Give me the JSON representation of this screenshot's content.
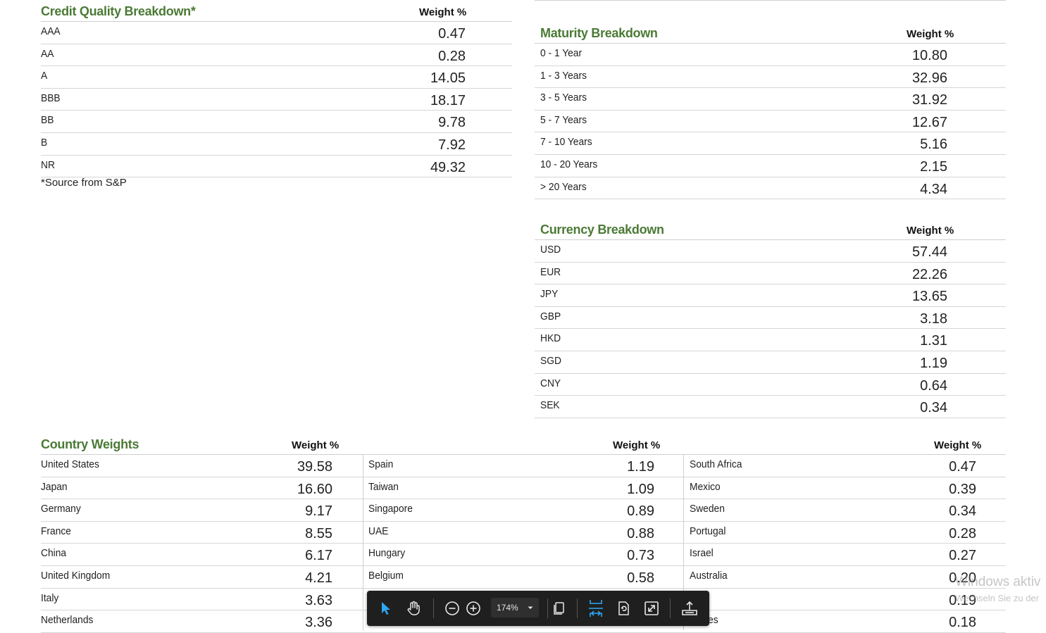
{
  "credit": {
    "title": "Credit Quality Breakdown*",
    "weight_header": "Weight %",
    "rows": [
      {
        "label": "AAA",
        "value": "0.47"
      },
      {
        "label": "AA",
        "value": "0.28"
      },
      {
        "label": "A",
        "value": "14.05"
      },
      {
        "label": "BBB",
        "value": "18.17"
      },
      {
        "label": "BB",
        "value": "9.78"
      },
      {
        "label": "B",
        "value": "7.92"
      },
      {
        "label": "NR",
        "value": "49.32"
      }
    ],
    "note": "*Source from S&P"
  },
  "maturity": {
    "title": "Maturity Breakdown",
    "weight_header": "Weight %",
    "rows": [
      {
        "label": "0 - 1 Year",
        "value": "10.80"
      },
      {
        "label": "1 - 3 Years",
        "value": "32.96"
      },
      {
        "label": "3 - 5 Years",
        "value": "31.92"
      },
      {
        "label": "5 - 7 Years",
        "value": "12.67"
      },
      {
        "label": "7 - 10 Years",
        "value": "5.16"
      },
      {
        "label": "10 - 20 Years",
        "value": "2.15"
      },
      {
        "label": "> 20 Years",
        "value": "4.34"
      }
    ]
  },
  "currency": {
    "title": "Currency Breakdown",
    "weight_header": "Weight %",
    "rows": [
      {
        "label": "USD",
        "value": "57.44"
      },
      {
        "label": "EUR",
        "value": "22.26"
      },
      {
        "label": "JPY",
        "value": "13.65"
      },
      {
        "label": "GBP",
        "value": "3.18"
      },
      {
        "label": "HKD",
        "value": "1.31"
      },
      {
        "label": "SGD",
        "value": "1.19"
      },
      {
        "label": "CNY",
        "value": "0.64"
      },
      {
        "label": "SEK",
        "value": "0.34"
      }
    ]
  },
  "country": {
    "title": "Country Weights",
    "columns": [
      {
        "weight_header": "Weight %",
        "rows": [
          {
            "label": "United States",
            "value": "39.58"
          },
          {
            "label": "Japan",
            "value": "16.60"
          },
          {
            "label": "Germany",
            "value": "9.17"
          },
          {
            "label": "France",
            "value": "8.55"
          },
          {
            "label": "China",
            "value": "6.17"
          },
          {
            "label": "United Kingdom",
            "value": "4.21"
          },
          {
            "label": "Italy",
            "value": "3.63"
          },
          {
            "label": "Netherlands",
            "value": "3.36"
          }
        ]
      },
      {
        "weight_header": "Weight %",
        "rows": [
          {
            "label": "Spain",
            "value": "1.19"
          },
          {
            "label": "Taiwan",
            "value": "1.09"
          },
          {
            "label": "Singapore",
            "value": "0.89"
          },
          {
            "label": "UAE",
            "value": "0.88"
          },
          {
            "label": "Hungary",
            "value": "0.73"
          },
          {
            "label": "Belgium",
            "value": "0.58"
          },
          {
            "label": "",
            "value": ""
          },
          {
            "label": "",
            "value": ""
          }
        ]
      },
      {
        "weight_header": "Weight %",
        "rows": [
          {
            "label": "South Africa",
            "value": "0.47"
          },
          {
            "label": "Mexico",
            "value": "0.39"
          },
          {
            "label": "Sweden",
            "value": "0.34"
          },
          {
            "label": "Portugal",
            "value": "0.28"
          },
          {
            "label": "Israel",
            "value": "0.27"
          },
          {
            "label": "Australia",
            "value": "0.20"
          },
          {
            "label": "land",
            "value": "0.19"
          },
          {
            "label": "ppines",
            "value": "0.18"
          }
        ]
      }
    ]
  },
  "viewer_toolbar": {
    "zoom_level": "174%",
    "icons": [
      "select-cursor-icon",
      "hand-pan-icon",
      "zoom-out-icon",
      "zoom-in-icon",
      "page-copy-icon",
      "fit-width-icon",
      "rotate-page-icon",
      "fullscreen-icon",
      "export-tray-icon"
    ],
    "accent_color": "#2ea8f5"
  },
  "watermark": {
    "line1": "Windows aktiv",
    "line2": "Wechseln Sie zu der"
  }
}
